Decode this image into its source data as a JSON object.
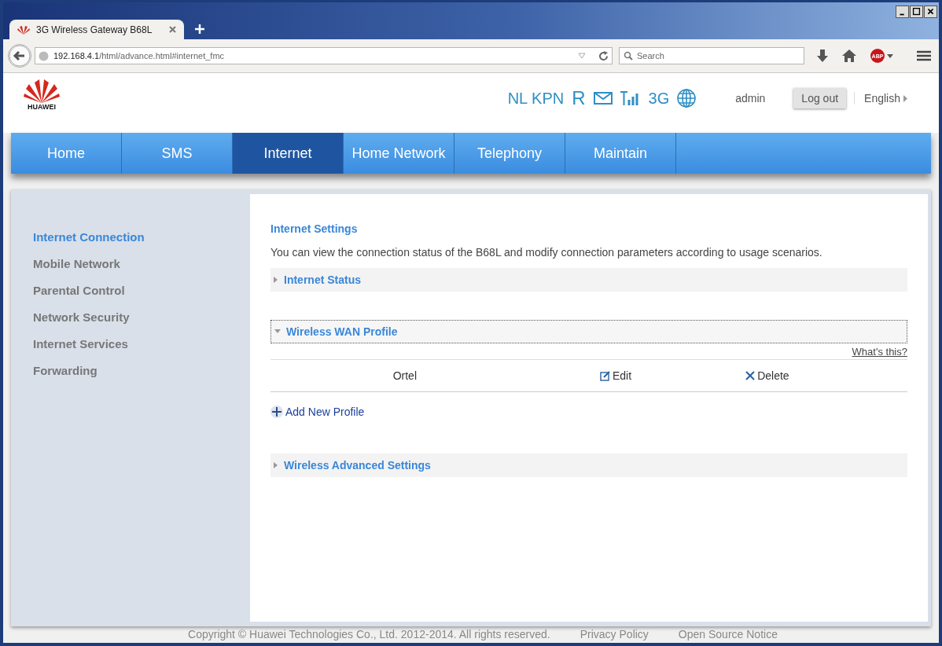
{
  "browser": {
    "tab_title": "3G Wireless Gateway B68L",
    "url_host": "192.168.4.1",
    "url_path": "/html/advance.html#internet_fmc",
    "search_placeholder": "Search",
    "abp_label": "ABP"
  },
  "header": {
    "logo_text": "HUAWEI",
    "operator": "NL KPN",
    "roaming": "R",
    "network_type": "3G",
    "user": "admin",
    "logout": "Log out",
    "language": "English"
  },
  "nav": [
    {
      "label": "Home",
      "selected": false
    },
    {
      "label": "SMS",
      "selected": false
    },
    {
      "label": "Internet",
      "selected": true
    },
    {
      "label": "Home Network",
      "selected": false
    },
    {
      "label": "Telephony",
      "selected": false
    },
    {
      "label": "Maintain",
      "selected": false
    }
  ],
  "sidebar": [
    {
      "label": "Internet Connection",
      "selected": true
    },
    {
      "label": "Mobile Network",
      "selected": false
    },
    {
      "label": "Parental Control",
      "selected": false
    },
    {
      "label": "Network Security",
      "selected": false
    },
    {
      "label": "Internet Services",
      "selected": false
    },
    {
      "label": "Forwarding",
      "selected": false
    }
  ],
  "content": {
    "title": "Internet Settings",
    "description": "You can view the connection status of the B68L and modify connection parameters according to usage scenarios.",
    "sections": [
      {
        "title": "Internet Status",
        "expanded": false
      },
      {
        "title": "Wireless WAN Profile",
        "expanded": true,
        "help_link": "What's this?",
        "profiles": [
          {
            "name": "Ortel",
            "edit": "Edit",
            "delete": "Delete"
          }
        ],
        "add_label": "Add New Profile"
      },
      {
        "title": "Wireless Advanced Settings",
        "expanded": false
      }
    ]
  },
  "footer": {
    "copyright": "Copyright © Huawei Technologies Co., Ltd. 2012-2014. All rights reserved.",
    "links": [
      "Privacy Policy",
      "Open Source Notice"
    ]
  }
}
